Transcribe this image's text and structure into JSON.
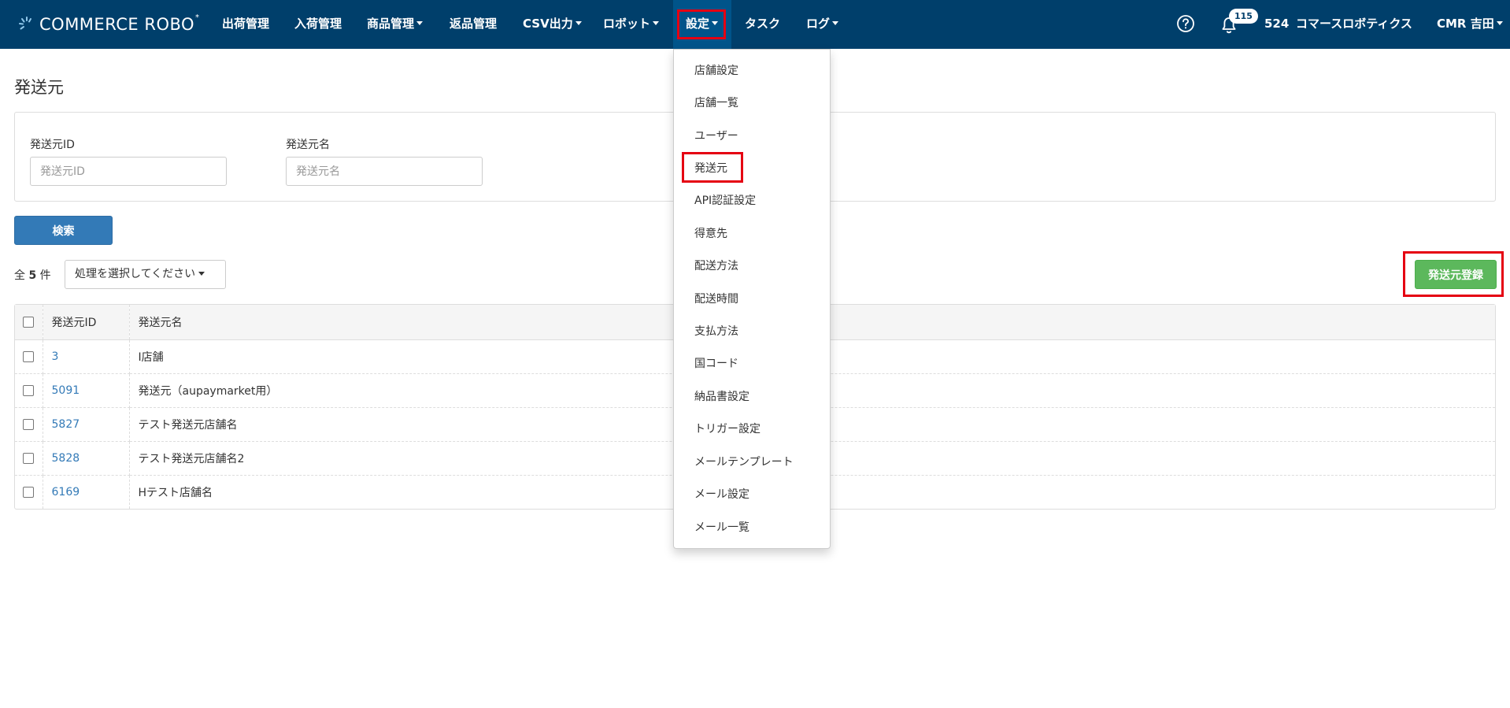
{
  "navbar": {
    "brand": "COMMERCE ROBO",
    "brand_mark": "*",
    "items": [
      {
        "label": "出荷管理",
        "dropdown": false
      },
      {
        "label": "入荷管理",
        "dropdown": false
      },
      {
        "label": "商品管理",
        "dropdown": true
      },
      {
        "label": "返品管理",
        "dropdown": false
      },
      {
        "label": "CSV出力",
        "dropdown": true
      },
      {
        "label": "ロボット",
        "dropdown": true
      },
      {
        "label": "設定",
        "dropdown": true,
        "active": true
      },
      {
        "label": "タスク",
        "dropdown": false
      },
      {
        "label": "ログ",
        "dropdown": true
      }
    ],
    "notification_count": "115",
    "shop_code": "524",
    "company": "コマースロボティクス",
    "user": "CMR 吉田",
    "icons": {
      "help": "help-circle-icon",
      "bell": "bell-icon"
    }
  },
  "page": {
    "title": "発送元",
    "search": {
      "id_label": "発送元ID",
      "id_placeholder": "発送元ID",
      "name_label": "発送元名",
      "name_placeholder": "発送元名",
      "button": "検索"
    },
    "count_prefix": "全",
    "count": "5",
    "count_suffix": "件",
    "action_select": "処理を選択してください",
    "register_button": "発送元登録"
  },
  "table": {
    "headers": [
      "発送元ID",
      "発送元名"
    ],
    "rows": [
      {
        "id": "3",
        "name": "I店舗"
      },
      {
        "id": "5091",
        "name": "発送元（aupaymarket用）"
      },
      {
        "id": "5827",
        "name": "テスト発送元店舗名"
      },
      {
        "id": "5828",
        "name": "テスト発送元店舗名2"
      },
      {
        "id": "6169",
        "name": "Hテスト店舗名"
      }
    ]
  },
  "settings_menu": {
    "items": [
      "店舗設定",
      "店舗一覧",
      "ユーザー",
      "発送元",
      "API認証設定",
      "得意先",
      "配送方法",
      "配送時間",
      "支払方法",
      "国コード",
      "納品書設定",
      "トリガー設定",
      "メールテンプレート",
      "メール設定",
      "メール一覧"
    ],
    "highlighted": "発送元"
  },
  "colors": {
    "navbar": "#003f6b",
    "active_nav": "#00548a",
    "primary": "#337ab7",
    "success": "#5cb85c",
    "highlight_frame": "#e50012",
    "link": "#337ab7"
  }
}
